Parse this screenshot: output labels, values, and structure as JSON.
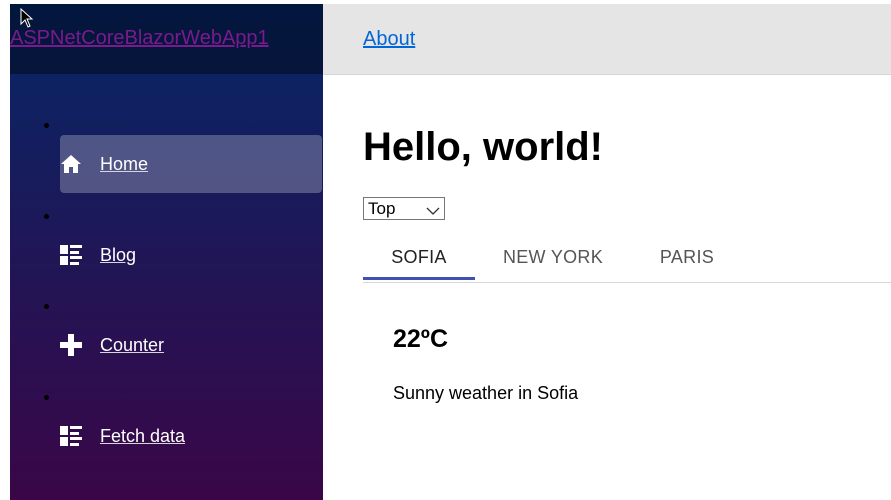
{
  "app": {
    "brand": "ASPNetCoreBlazorWebApp1"
  },
  "sidebar": {
    "items": [
      {
        "label": "Home",
        "icon": "home-icon",
        "active": true
      },
      {
        "label": "Blog",
        "icon": "list-icon",
        "active": false
      },
      {
        "label": "Counter",
        "icon": "plus-icon",
        "active": false
      },
      {
        "label": "Fetch data",
        "icon": "list-icon",
        "active": false
      }
    ]
  },
  "top_row": {
    "about_label": "About"
  },
  "main": {
    "title": "Hello, world!",
    "select": {
      "value": "Top"
    },
    "tabs": [
      {
        "label": "SOFIA",
        "active": true
      },
      {
        "label": "NEW YORK",
        "active": false
      },
      {
        "label": "PARIS",
        "active": false
      }
    ],
    "weather": {
      "temperature": "22ºC",
      "description": "Sunny weather in Sofia"
    }
  },
  "colors": {
    "sidebar_top": "#052767",
    "sidebar_bottom": "#3a0647",
    "tab_indicator": "#3f51b5",
    "link": "#0366d6"
  }
}
